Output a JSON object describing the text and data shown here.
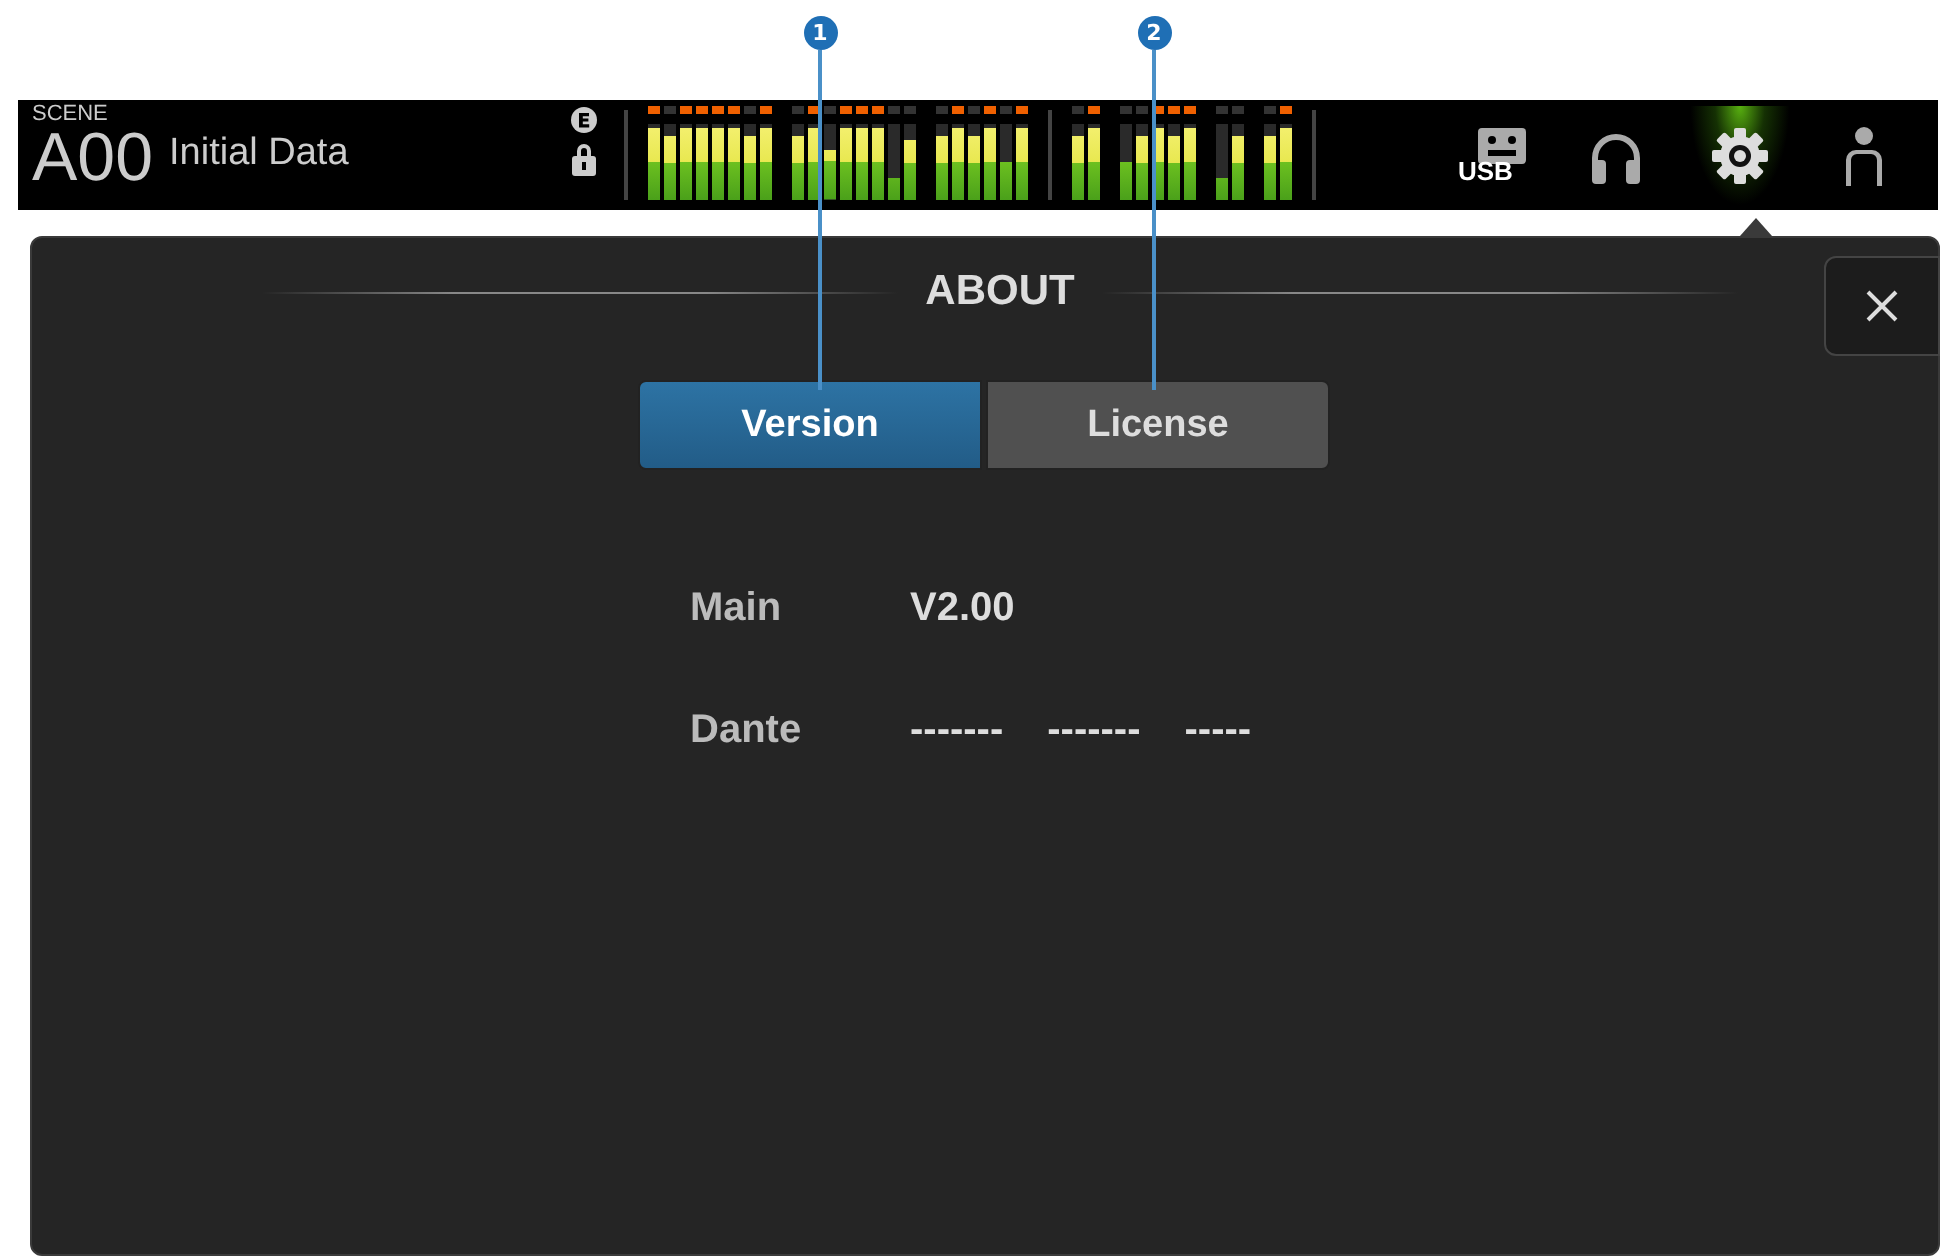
{
  "callouts": [
    {
      "number": "1"
    },
    {
      "number": "2"
    }
  ],
  "header": {
    "scene_label": "SCENE",
    "scene_number": "A00",
    "scene_name": "Initial Data",
    "meter_sections": [
      {
        "groups": [
          [
            {
              "level": 0.95,
              "peak": true
            },
            {
              "level": 0.85,
              "peak": false
            },
            {
              "level": 0.95,
              "peak": true
            },
            {
              "level": 0.95,
              "peak": true
            },
            {
              "level": 0.95,
              "peak": true
            },
            {
              "level": 0.95,
              "peak": true
            },
            {
              "level": 0.85,
              "peak": false
            },
            {
              "level": 0.95,
              "peak": true
            }
          ],
          [
            {
              "level": 0.85,
              "peak": false
            },
            {
              "level": 0.95,
              "peak": true
            },
            {
              "level": 0.65,
              "peak": false
            },
            {
              "level": 0.95,
              "peak": true
            },
            {
              "level": 0.95,
              "peak": true
            },
            {
              "level": 0.95,
              "peak": true
            },
            {
              "level": 0.3,
              "peak": false
            },
            {
              "level": 0.8,
              "peak": false
            }
          ],
          [
            {
              "level": 0.85,
              "peak": false
            },
            {
              "level": 0.95,
              "peak": true
            },
            {
              "level": 0.85,
              "peak": false
            },
            {
              "level": 0.95,
              "peak": true
            },
            {
              "level": 0.5,
              "peak": false
            },
            {
              "level": 0.95,
              "peak": true
            }
          ]
        ]
      },
      {
        "groups": [
          [
            {
              "level": 0.85,
              "peak": false
            },
            {
              "level": 0.95,
              "peak": true
            }
          ],
          [
            {
              "level": 0.5,
              "peak": false
            },
            {
              "level": 0.85,
              "peak": false
            },
            {
              "level": 0.95,
              "peak": true
            },
            {
              "level": 0.85,
              "peak": true
            },
            {
              "level": 0.95,
              "peak": true
            }
          ],
          [
            {
              "level": 0.3,
              "peak": false
            },
            {
              "level": 0.85,
              "peak": false
            }
          ],
          [
            {
              "level": 0.85,
              "peak": false
            },
            {
              "level": 0.95,
              "peak": true
            }
          ]
        ]
      }
    ]
  },
  "toolbar": [
    {
      "kind": "usb",
      "label": "USB",
      "selected": false
    },
    {
      "kind": "headphones",
      "selected": false
    },
    {
      "kind": "gear",
      "selected": true
    },
    {
      "kind": "user",
      "selected": false
    }
  ],
  "panel": {
    "title": "ABOUT",
    "tabs": [
      {
        "label": "Version",
        "selected": true
      },
      {
        "label": "License",
        "selected": false
      }
    ],
    "rows": [
      {
        "label": "Main",
        "values": [
          "V2.00"
        ]
      },
      {
        "label": "Dante",
        "values": [
          "-------",
          "-------",
          "-----"
        ]
      }
    ]
  }
}
